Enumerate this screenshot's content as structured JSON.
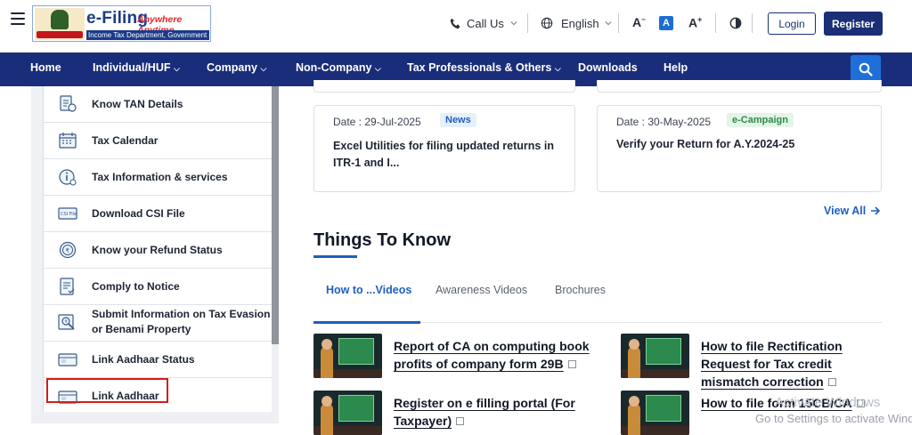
{
  "header": {
    "logo_title": "e-Filing",
    "logo_tagline": "Anywhere Anytime",
    "logo_subtitle": "Income Tax Department, Government of India",
    "call_us": "Call Us",
    "language": "English",
    "font_decrease": "A",
    "font_default": "A",
    "font_increase": "A",
    "login_label": "Login",
    "register_label": "Register"
  },
  "nav": {
    "items": [
      {
        "label": "Home"
      },
      {
        "label": "Individual/HUF"
      },
      {
        "label": "Company"
      },
      {
        "label": "Non-Company"
      },
      {
        "label": "Tax Professionals & Others"
      },
      {
        "label": "Downloads"
      },
      {
        "label": "Help"
      }
    ]
  },
  "sidebar": {
    "items": [
      {
        "label": "Know TAN Details",
        "icon": "tan-details-icon"
      },
      {
        "label": "Tax Calendar",
        "icon": "calendar-icon"
      },
      {
        "label": "Tax Information & services",
        "icon": "info-icon"
      },
      {
        "label": "Download CSI File",
        "icon": "csi-file-icon"
      },
      {
        "label": "Know your Refund Status",
        "icon": "refund-icon"
      },
      {
        "label": "Comply to Notice",
        "icon": "notice-icon"
      },
      {
        "label": "Submit Information on Tax Evasion or Benami Property",
        "icon": "evasion-icon"
      },
      {
        "label": "Link Aadhaar Status",
        "icon": "aadhaar-card-icon"
      },
      {
        "label": "Link Aadhaar",
        "icon": "aadhaar-card-icon"
      }
    ]
  },
  "news": {
    "cards": [
      {
        "date": "Date : 29-Jul-2025",
        "badge": "News",
        "text": "Excel Utilities for filing updated returns in ITR-1 and I..."
      },
      {
        "date": "Date : 30-May-2025",
        "badge": "e-Campaign",
        "text": "Verify your Return for A.Y.2024-25"
      }
    ],
    "view_all": "View All"
  },
  "things_to_know": {
    "heading": "Things To Know",
    "tabs": [
      {
        "label": "How to ...Videos"
      },
      {
        "label": "Awareness Videos"
      },
      {
        "label": "Brochures"
      }
    ],
    "videos": [
      {
        "title": "Report of CA on computing book profits of company form 29B"
      },
      {
        "title": "How to file Rectification Request for Tax credit mismatch correction"
      },
      {
        "title": "Register on e filling portal (For Taxpayer)"
      },
      {
        "title": "How to file form 15CB/CA"
      }
    ]
  },
  "overlay": {
    "activate_windows": "Activate Windows",
    "activate_hint": "Go to Settings to activate Windows."
  },
  "colors": {
    "brand_navy": "#1a2d7a",
    "accent_blue": "#1f5fbf",
    "highlight_red": "#d21c1c",
    "news_badge": "#e6f0fb",
    "campaign_badge": "#e4f5e8"
  }
}
